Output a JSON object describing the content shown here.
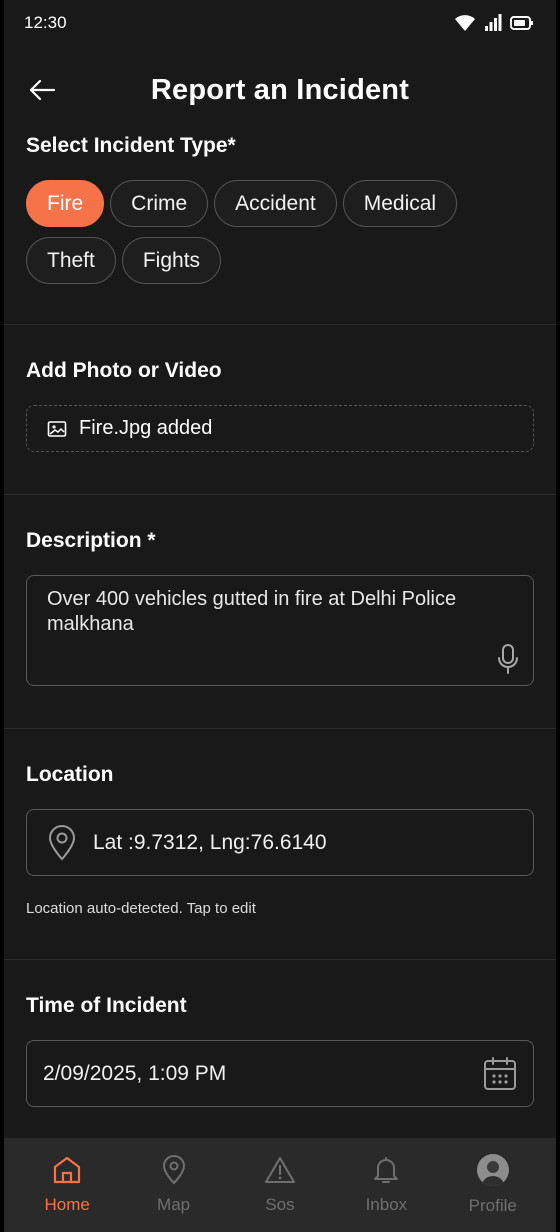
{
  "status_bar": {
    "time": "12:30",
    "icons": [
      "wifi-icon",
      "signal-icon",
      "battery-icon"
    ]
  },
  "header": {
    "title": "Report an Incident",
    "back_icon": "arrow-left-icon"
  },
  "incident_type": {
    "title": "Select Incident Type*",
    "options": [
      {
        "label": "Fire",
        "selected": true
      },
      {
        "label": "Crime",
        "selected": false
      },
      {
        "label": "Accident",
        "selected": false
      },
      {
        "label": "Medical",
        "selected": false
      },
      {
        "label": "Theft",
        "selected": false
      },
      {
        "label": "Fights",
        "selected": false
      }
    ]
  },
  "media": {
    "title": "Add Photo or Video",
    "value": "Fire.Jpg added",
    "icon": "image-icon"
  },
  "description": {
    "title": "Description *",
    "value": "Over 400 vehicles gutted in fire at Delhi Police malkhana",
    "icon": "microphone-icon"
  },
  "location": {
    "title": "Location",
    "value": "Lat :9.7312, Lng:76.6140",
    "hint": "Location auto-detected. Tap to edit",
    "icon": "map-pin-icon"
  },
  "time": {
    "title": "Time of Incident",
    "value": "2/09/2025, 1:09 PM",
    "icon": "calendar-icon"
  },
  "nav": {
    "items": [
      {
        "label": "Home",
        "icon": "home-icon",
        "active": true
      },
      {
        "label": "Map",
        "icon": "map-pin-icon",
        "active": false
      },
      {
        "label": "Sos",
        "icon": "warning-icon",
        "active": false
      },
      {
        "label": "Inbox",
        "icon": "bell-icon",
        "active": false
      },
      {
        "label": "Profile",
        "icon": "avatar",
        "active": false
      }
    ]
  },
  "colors": {
    "accent": "#f6734a",
    "background": "#191919",
    "nav_background": "#2a2a2a",
    "inactive": "#6f6f6f"
  }
}
